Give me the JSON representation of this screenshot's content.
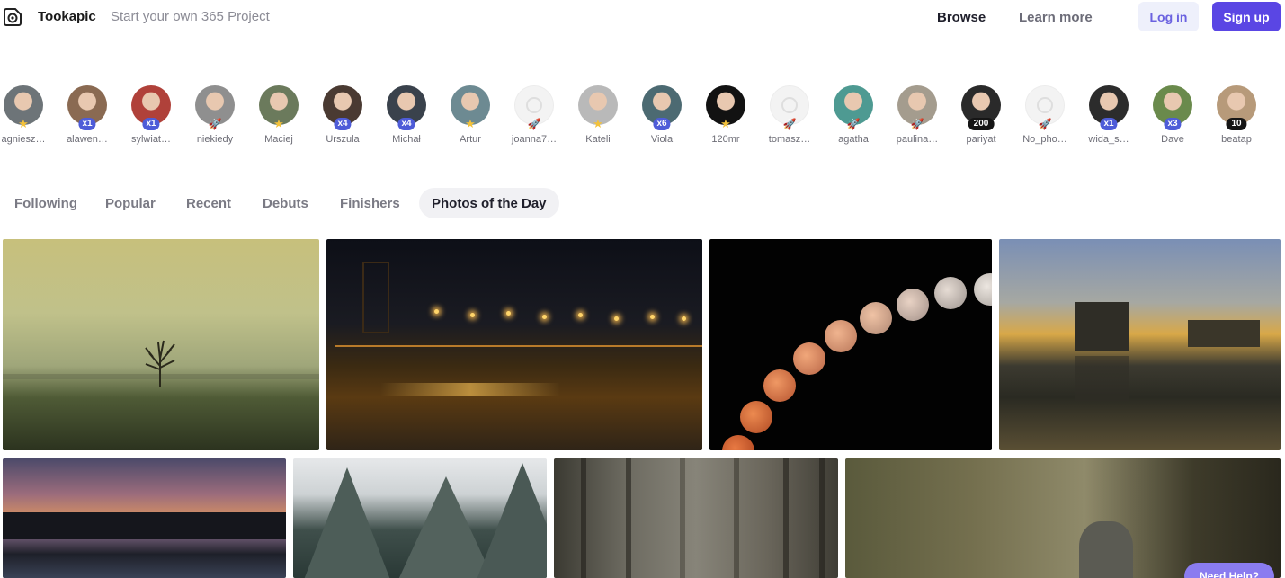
{
  "header": {
    "brand": "Tookapic",
    "tagline": "Start your own 365 Project",
    "nav": {
      "browse": "Browse",
      "learn_more": "Learn more"
    },
    "login_label": "Log in",
    "signup_label": "Sign up",
    "logo_icon": "tookapic-logo-icon"
  },
  "avatars": [
    {
      "name": "agniesz…",
      "badge": "star",
      "badge_text": "★",
      "color": "#6d7478"
    },
    {
      "name": "alawen…",
      "badge": "count",
      "badge_text": "x1",
      "color": "#8a6a52"
    },
    {
      "name": "sylwiat…",
      "badge": "count",
      "badge_text": "x1",
      "color": "#b0413a"
    },
    {
      "name": "niekiedy",
      "badge": "rocket",
      "badge_text": "🚀",
      "color": "#8f8f8f"
    },
    {
      "name": "Maciej",
      "badge": "star",
      "badge_text": "★",
      "color": "#6b7a5c"
    },
    {
      "name": "Urszula",
      "badge": "count",
      "badge_text": "x4",
      "color": "#4a3a32"
    },
    {
      "name": "Michał",
      "badge": "count",
      "badge_text": "x4",
      "color": "#3a424c"
    },
    {
      "name": "Artur",
      "badge": "star",
      "badge_text": "★",
      "color": "#6d8a92"
    },
    {
      "name": "joanna7…",
      "badge": "rocket",
      "badge_text": "🚀",
      "color": "placeholder"
    },
    {
      "name": "Kateli",
      "badge": "star",
      "badge_text": "★",
      "color": "#b9b9b9"
    },
    {
      "name": "Viola",
      "badge": "count",
      "badge_text": "x6",
      "color": "#4c6a72"
    },
    {
      "name": "120mr",
      "badge": "star",
      "badge_text": "★",
      "color": "#121212"
    },
    {
      "name": "tomasz…",
      "badge": "rocket",
      "badge_text": "🚀",
      "color": "placeholder"
    },
    {
      "name": "agatha",
      "badge": "rocket",
      "badge_text": "🚀",
      "color": "#4e9a92"
    },
    {
      "name": "paulina…",
      "badge": "rocket",
      "badge_text": "🚀",
      "color": "#a49c8e"
    },
    {
      "name": "pariyat",
      "badge": "dark",
      "badge_text": "200",
      "color": "#2a2a2a"
    },
    {
      "name": "No_pho…",
      "badge": "rocket",
      "badge_text": "🚀",
      "color": "placeholder"
    },
    {
      "name": "wida_s…",
      "badge": "count",
      "badge_text": "x1",
      "color": "#2c2c2c"
    },
    {
      "name": "Dave",
      "badge": "count",
      "badge_text": "x3",
      "color": "#6a8a4c"
    },
    {
      "name": "beatap",
      "badge": "dark",
      "badge_text": "10",
      "color": "#b79a7a"
    }
  ],
  "tabs": [
    {
      "label": "Following",
      "active": false
    },
    {
      "label": "Popular",
      "active": false
    },
    {
      "label": "Recent",
      "active": false
    },
    {
      "label": "Debuts",
      "active": false
    },
    {
      "label": "Finishers",
      "active": false
    },
    {
      "label": "Photos of the Day",
      "active": true
    }
  ],
  "photos": [
    {
      "subject": "foggy-field-lone-tree"
    },
    {
      "subject": "lit-pier-at-night"
    },
    {
      "subject": "lunar-eclipse-sequence"
    },
    {
      "subject": "ruin-reflection-sunset"
    },
    {
      "subject": "lake-sunset-forest"
    },
    {
      "subject": "snowy-spruce-trees"
    },
    {
      "subject": "misty-forest"
    },
    {
      "subject": "squirrel-on-branch"
    }
  ],
  "help_label": "Need Help?"
}
